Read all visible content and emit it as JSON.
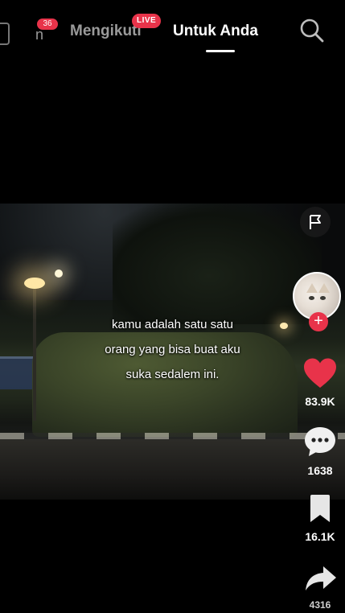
{
  "topbar": {
    "friends_badge": "36",
    "friends_label_fragment": "n",
    "tab_following": "Mengikuti",
    "live_badge": "LIVE",
    "tab_foryou": "Untuk Anda"
  },
  "video": {
    "caption_lines": [
      "kamu adalah satu satu",
      "orang yang bisa buat aku",
      "suka sedalem ini."
    ]
  },
  "actions": {
    "like_count": "83.9K",
    "comment_count": "1638",
    "save_count": "16.1K",
    "share_count": "4316"
  },
  "colors": {
    "accent": "#e8334a",
    "background": "#000000"
  },
  "icons": [
    "live-icon",
    "search-icon",
    "flag-icon",
    "plus-icon",
    "heart-icon",
    "comment-icon",
    "bookmark-icon",
    "share-icon"
  ]
}
